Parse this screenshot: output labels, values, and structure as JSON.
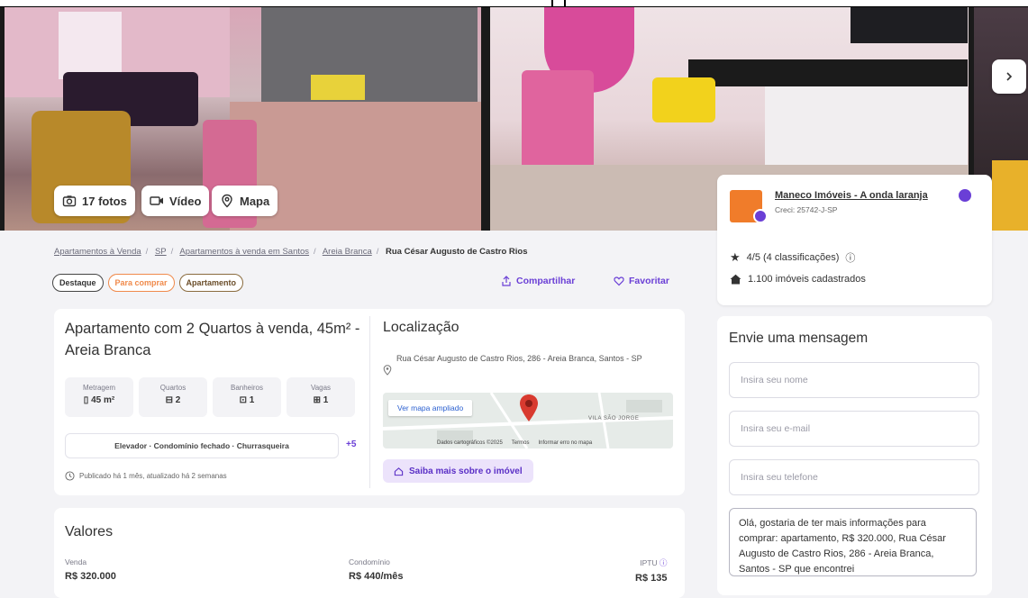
{
  "gallery": {
    "photos_label": "17 fotos",
    "video_label": "Vídeo",
    "map_label": "Mapa"
  },
  "breadcrumb": [
    "Apartamentos à Venda",
    "SP",
    "Apartamentos à venda em Santos",
    "Areia Branca",
    "Rua César Augusto de Castro Rios"
  ],
  "tags": [
    "Destaque",
    "Para comprar",
    "Apartamento"
  ],
  "actions": {
    "share": "Compartilhar",
    "favorite": "Favoritar"
  },
  "listing": {
    "title": "Apartamento com 2 Quartos à venda, 45m² - Areia Branca",
    "stats": [
      {
        "label": "Metragem",
        "value": "45 m²"
      },
      {
        "label": "Quartos",
        "value": "2"
      },
      {
        "label": "Banheiros",
        "value": "1"
      },
      {
        "label": "Vagas",
        "value": "1"
      }
    ],
    "amenities": "Elevador · Condomínio fechado · Churrasqueira",
    "amenities_more": "+5",
    "published": "Publicado há 1 mês, atualizado há 2 semanas"
  },
  "location": {
    "title": "Localização",
    "address": "Rua César Augusto de Castro Rios, 286 - Areia Branca, Santos - SP",
    "map_link": "Ver mapa ampliado",
    "map_area": "VILA SÃO JORGE",
    "map_footer": [
      "Dados cartográficos ©2025",
      "Termos",
      "Informar erro no mapa"
    ],
    "more_button": "Saiba mais sobre o imóvel"
  },
  "values": {
    "title": "Valores",
    "sale_label": "Venda",
    "sale_value": "R$ 320.000",
    "condo_label": "Condomínio",
    "condo_value": "R$ 440/mês",
    "iptu_label": "IPTU",
    "iptu_value": "R$ 135"
  },
  "agency": {
    "name": "Maneco Imóveis - A onda laranja",
    "creci": "Creci: 25742-J-SP",
    "rating": "4/5 (4 classificações)",
    "listings": "1.100 imóveis cadastrados"
  },
  "message": {
    "title": "Envie uma mensagem",
    "name_placeholder": "Insira seu nome",
    "email_placeholder": "Insira seu e-mail",
    "phone_placeholder": "Insira seu telefone",
    "text": "Olá, gostaria de ter mais informações para comprar: apartamento, R$ 320.000, Rua César Augusto de Castro Rios, 286 - Areia Branca, Santos - SP que encontrei"
  },
  "colors": {
    "accent": "#6a3fd6",
    "agency_orange": "#f07c2a",
    "background": "#f3f3f6"
  }
}
